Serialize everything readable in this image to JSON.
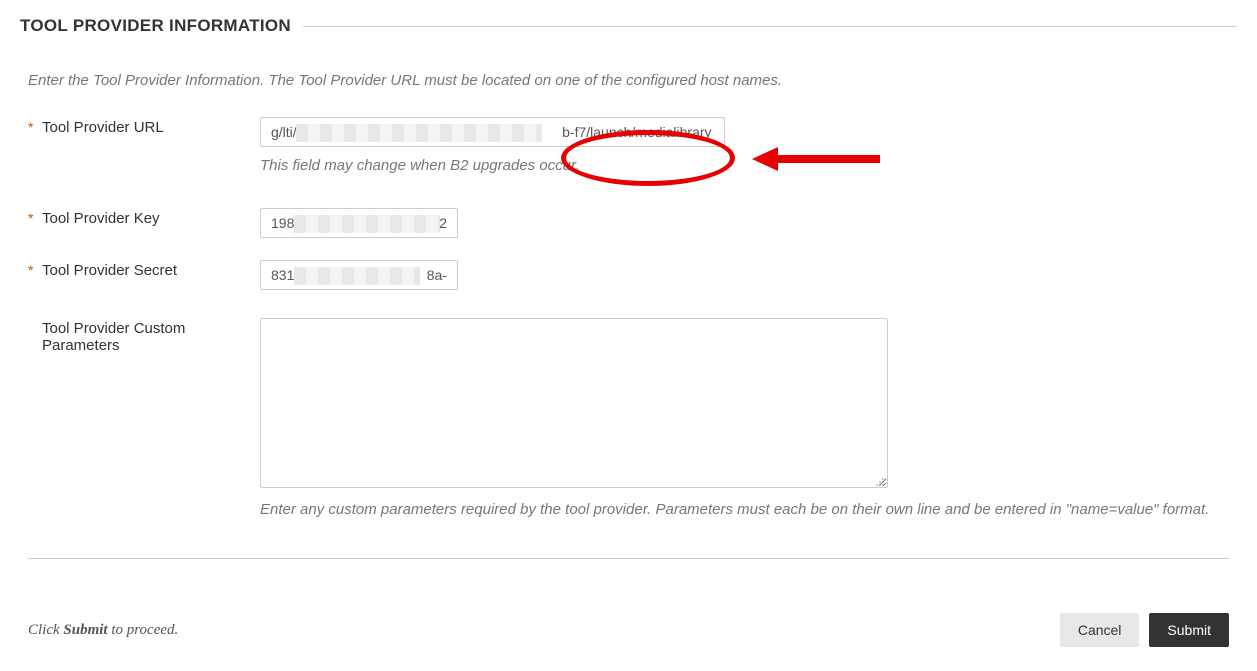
{
  "section": {
    "title": "TOOL PROVIDER INFORMATION",
    "intro": "Enter the Tool Provider Information. The Tool Provider URL must be located on one of the configured host names."
  },
  "fields": {
    "url": {
      "label": "Tool Provider URL",
      "value_prefix": "g/lti/1fd",
      "value_suffix": "b-f7/launch/medialibrary",
      "help": "This field may change when B2 upgrades occur."
    },
    "key": {
      "label": "Tool Provider Key",
      "value_prefix": "198",
      "value_suffix": "-2"
    },
    "secret": {
      "label": "Tool Provider Secret",
      "value_prefix": "831",
      "value_suffix": "8a-"
    },
    "custom": {
      "label": "Tool Provider Custom Parameters",
      "value": "",
      "help": "Enter any custom parameters required by the tool provider. Parameters must each be on their own line and be entered in \"name=value\" format."
    }
  },
  "footer": {
    "prompt_prefix": "Click ",
    "prompt_strong": "Submit",
    "prompt_suffix": " to proceed.",
    "cancel": "Cancel",
    "submit": "Submit"
  },
  "required_marker": "*"
}
